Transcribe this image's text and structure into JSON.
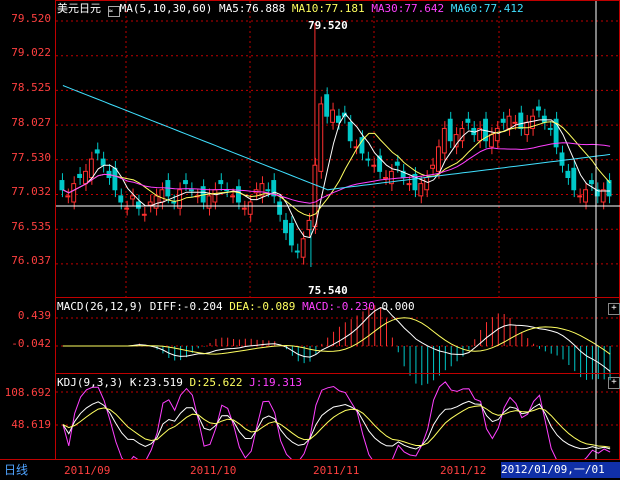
{
  "main": {
    "symbol": "美元日元",
    "ma_label": "MA(5,10,30,60)",
    "ma5": "MA5:76.888",
    "ma10": "MA10:77.181",
    "ma30": "MA30:77.642",
    "ma60": "MA60:77.412",
    "high_label": "79.520",
    "low_label": "75.540",
    "y_ticks": [
      "79.520",
      "79.022",
      "78.525",
      "78.027",
      "77.530",
      "77.032",
      "76.535",
      "76.037"
    ]
  },
  "macd": {
    "label": "MACD(26,12,9)",
    "diff": "DIFF:-0.204",
    "dea": "DEA:-0.089",
    "macd": "MACD:-0.230",
    "zero": "0.000",
    "y_ticks": [
      "0.439",
      "-0.042"
    ]
  },
  "kdj": {
    "label": "KDJ(9,3,3)",
    "k": "K:23.519",
    "d": "D:25.622",
    "j": "J:19.313",
    "y_ticks": [
      "108.692",
      "48.619"
    ]
  },
  "bottom": {
    "period_button": "日线",
    "x_ticks": [
      "2011/09",
      "2011/10",
      "2011/11",
      "2011/12"
    ],
    "cursor_date": "2012/01/09,一/01"
  },
  "colors": {
    "up": "#ff3030",
    "down": "#00c8c8",
    "ma5": "#ffffff",
    "ma10": "#ffff60",
    "ma30": "#ff40ff",
    "ma60": "#40e0ff",
    "grid": "#c00000"
  },
  "chart_data": {
    "type": "candlestick",
    "price_range": [
      75.54,
      79.52
    ],
    "high_marker": 79.52,
    "low_marker": 75.54,
    "x_ticks": [
      "2011/09",
      "2011/10",
      "2011/11",
      "2011/12"
    ],
    "close": [
      76.8,
      76.7,
      76.9,
      77.0,
      77.1,
      77.3,
      77.4,
      77.2,
      77.0,
      76.8,
      76.6,
      76.5,
      76.7,
      76.5,
      76.4,
      76.6,
      76.7,
      76.8,
      76.7,
      76.6,
      76.8,
      76.9,
      76.8,
      76.7,
      76.6,
      76.7,
      76.8,
      76.9,
      76.8,
      76.7,
      76.6,
      76.5,
      76.6,
      76.8,
      76.9,
      76.8,
      76.7,
      76.4,
      76.1,
      75.9,
      75.8,
      76.0,
      76.3,
      77.2,
      78.2,
      78.0,
      78.1,
      77.9,
      78.0,
      77.6,
      77.5,
      77.4,
      77.3,
      77.2,
      77.1,
      77.0,
      77.1,
      77.2,
      77.0,
      76.9,
      76.8,
      76.9,
      77.0,
      77.2,
      77.5,
      77.8,
      77.6,
      77.7,
      77.8,
      77.9,
      77.7,
      77.8,
      77.6,
      77.7,
      77.8,
      77.9,
      78.0,
      77.9,
      77.8,
      77.9,
      78.0,
      78.1,
      77.9,
      77.8,
      77.5,
      77.2,
      77.0,
      76.8,
      76.7,
      76.8,
      76.9,
      76.7,
      76.8,
      76.7
    ]
  }
}
